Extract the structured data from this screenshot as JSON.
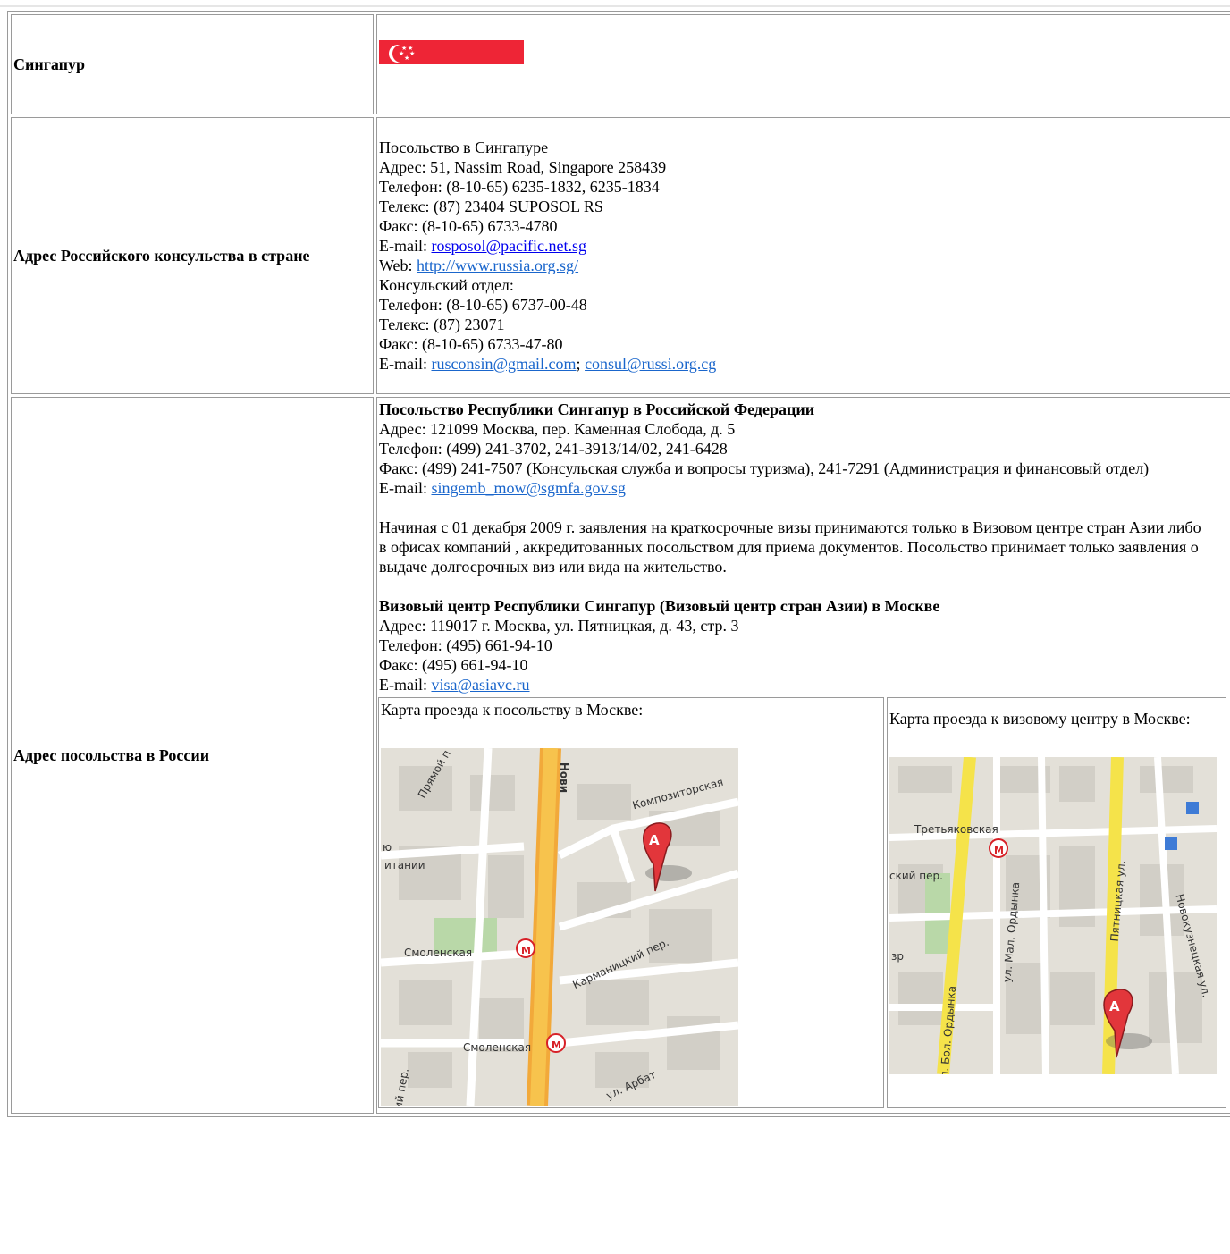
{
  "rows": {
    "country": {
      "label": "Сингапур",
      "flag_colors": {
        "red": "#ee2536",
        "white": "#ffffff"
      }
    },
    "consulate": {
      "label": "Адрес Российского консульства в стране",
      "lines": [
        "Посольство в Сингапуре",
        "Адрес: 51, Nassim Road, Singapore 258439",
        "Телефон: (8-10-65) 6235-1832, 6235-1834",
        "Телекс: (87) 23404 SUPOSOL RS",
        "Факс: (8-10-65) 6733-4780"
      ],
      "email_prefix": "E-mail: ",
      "email": "rosposol@pacific.net.sg",
      "web_prefix": "Web: ",
      "web": "http://www.russia.org.sg/",
      "lines2": [
        "Консульский отдел:",
        "Телефон: (8-10-65) 6737-00-48",
        "Телекс: (87) 23071",
        "Факс: (8-10-65) 6733-47-80"
      ],
      "email2_prefix": "E-mail: ",
      "email2a": "rusconsin@gmail.com",
      "email2_sep": "; ",
      "email2b": "consul@russi.org.cg"
    },
    "embassy": {
      "label": "Адрес посольства в России",
      "title": "Посольство Республики Сингапур в Российской Федерации",
      "lines": [
        "Адрес: 121099 Москва, пер. Каменная Слобода, д. 5",
        "Телефон: (499) 241-3702, 241-3913/14/02, 241-6428",
        "Факс: (499) 241-7507 (Консульская служба и вопросы туризма), 241-7291 (Администрация и финансовый отдел)"
      ],
      "email_prefix": "E-mail: ",
      "email": "singemb_mow@sgmfa.gov.sg",
      "notice": "Начиная с 01 декабря 2009 г. заявления на краткосрочные визы принимаются только в Визовом центре стран Азии либо в офисах компаний , аккредитованных посольством для приема документов. Посольство принимает только заявления о выдаче долгосрочных виз или вида на жительство.",
      "vc_title": "Визовый центр Республики Сингапур (Визовый центр стран Азии) в Москве",
      "vc_lines": [
        "Адрес: 119017 г. Москва, ул. Пятницкая, д. 43, стр. 3",
        "Телефон: (495) 661-94-10",
        "Факс: (495) 661-94-10"
      ],
      "vc_email_prefix": "E-mail: ",
      "vc_email": "visa@asiavc.ru",
      "map1_caption": "Карта проезда к посольству в Москве:",
      "map2_caption": "Карта проезда к визовому центру в Москве:",
      "map1_labels": {
        "a": "Прямой п",
        "b": "Нови",
        "c": "Композиторская",
        "d": "итании",
        "e": "Смоленская",
        "f": "Карманицкий пер.",
        "g": "Смоленская",
        "h": "ул. Арбат",
        "i": "ий пер.",
        "j": "ю"
      },
      "map2_labels": {
        "a": "Третьяковская",
        "b": "ский пер.",
        "c": "ул. Мал. Ордынка",
        "d": "ул. Бол. Ордынка",
        "e": "Пятницкая ул.",
        "f": "Новокузнецкая ул.",
        "g": "зр"
      },
      "marker_letter": "A",
      "metro_letter": "М"
    }
  }
}
